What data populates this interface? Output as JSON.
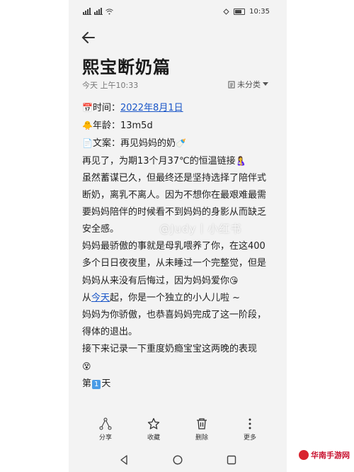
{
  "status_bar": {
    "left_icons": [
      "signal-icon",
      "signal-icon",
      "wifi-icon"
    ],
    "time": "10:35"
  },
  "header": {
    "title": "熙宝断奶篇",
    "timestamp": "今天 上午10:33",
    "category": "未分类"
  },
  "content": {
    "time_label": "时间：",
    "time_value": "2022年8月1日",
    "age_label": "年龄：",
    "age_value": "13m5d",
    "text_label": "文案：",
    "text_value": "再见妈妈的奶",
    "p1": "再见了，为期13个月37℃的恒温链接",
    "p2": "虽然蓄谋已久，但最终还是坚持选择了陪伴式断奶，离乳不离人。因为不想你在最艰难最需要妈妈陪伴的时候看不到妈妈的身影从而缺乏安全感。",
    "p3": "妈妈最骄傲的事就是母乳喂养了你，在这400多个日日夜夜里，从未睡过一个完整觉，但是妈妈从来没有后悔过，因为妈妈爱你",
    "p4_prefix": "从",
    "p4_link": "今天",
    "p4_suffix": "起，你是一个独立的小人儿啦 ~",
    "p5": "妈妈为你骄傲，也恭喜妈妈完成了这一阶段，得体的退出。",
    "p6": "接下来记录一下重度奶瘾宝宝这两晚的表现",
    "p7_prefix": "第",
    "p7_badge": "1",
    "p7_suffix": "天"
  },
  "watermark": "@Judy丨小红书",
  "toolbar": {
    "share": "分享",
    "favorite": "收藏",
    "delete": "删除",
    "more": "更多"
  },
  "corner_logo": "华南手游网",
  "colors": {
    "link": "#1a56c8",
    "background": "#f3f3f3",
    "text": "#222222"
  }
}
